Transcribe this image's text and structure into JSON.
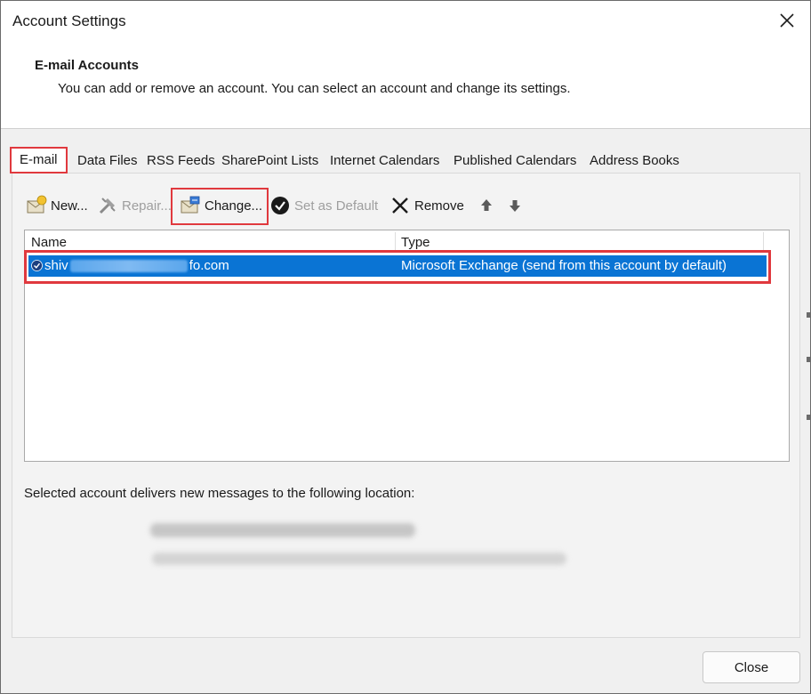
{
  "window": {
    "title": "Account Settings"
  },
  "header": {
    "title": "E-mail Accounts",
    "description": "You can add or remove an account. You can select an account and change its settings."
  },
  "tabs": [
    {
      "label": "E-mail",
      "active": true
    },
    {
      "label": "Data Files"
    },
    {
      "label": "RSS Feeds"
    },
    {
      "label": "SharePoint Lists"
    },
    {
      "label": "Internet Calendars"
    },
    {
      "label": "Published Calendars"
    },
    {
      "label": "Address Books"
    }
  ],
  "toolbar": {
    "new_label": "New...",
    "repair_label": "Repair...",
    "change_label": "Change...",
    "set_default_label": "Set as Default",
    "remove_label": "Remove"
  },
  "accounts_list": {
    "columns": [
      "Name",
      "Type"
    ],
    "rows": [
      {
        "name_prefix": "shiv",
        "name_suffix": "fo.com",
        "type": "Microsoft Exchange (send from this account by default)",
        "selected": true,
        "is_default": true
      }
    ]
  },
  "delivery": {
    "label": "Selected account delivers new messages to the following location:"
  },
  "footer": {
    "close_label": "Close"
  },
  "colors": {
    "selection": "#0a74d4",
    "highlight_box": "#e0393e"
  },
  "icons": [
    "close-icon",
    "new-account-icon",
    "repair-icon",
    "change-icon",
    "set-default-icon",
    "remove-icon",
    "move-up-icon",
    "move-down-icon",
    "default-check-icon"
  ]
}
